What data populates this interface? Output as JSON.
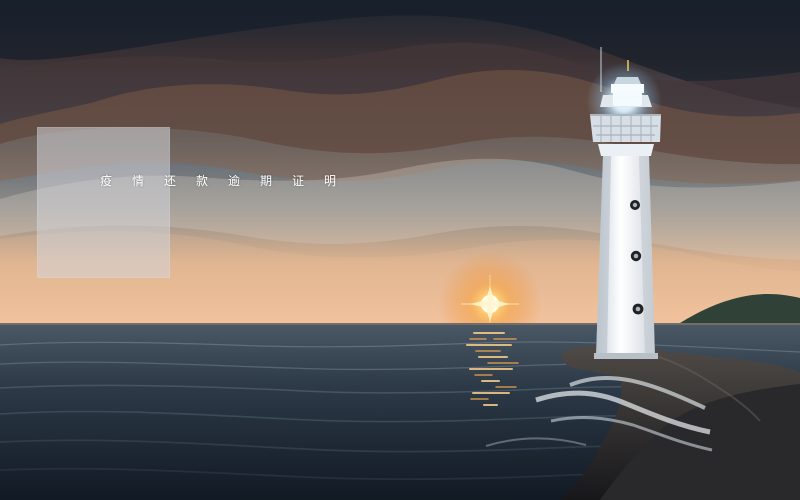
{
  "title": "疫情还款逾期证明",
  "colors": {
    "overlay": "#d6d6da",
    "text": "#ffffff"
  }
}
